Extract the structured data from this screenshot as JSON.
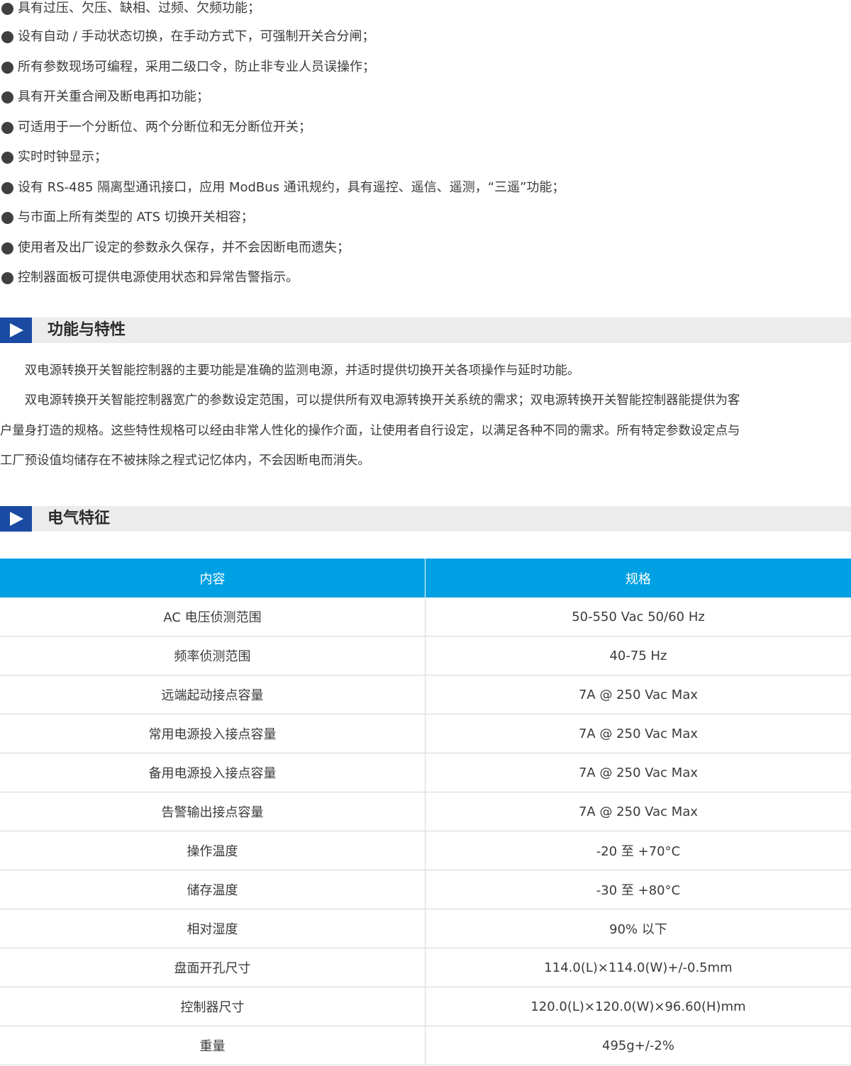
{
  "features": [
    "具有过压、欠压、缺相、过频、欠频功能；",
    "设有自动 / 手动状态切换，在手动方式下，可强制开关合分闸；",
    "所有参数现场可编程，采用二级口令，防止非专业人员误操作；",
    "具有开关重合闸及断电再扣功能；",
    "可适用于一个分断位、两个分断位和无分断位开关；",
    "实时时钟显示；",
    "设有 RS-485 隔离型通讯接口，应用 ModBus 通讯规约，具有遥控、遥信、遥测，“三遥”功能；",
    "与市面上所有类型的 ATS 切换开关相容；",
    "使用者及出厂设定的参数永久保存，并不会因断电而遗失；",
    "控制器面板可提供电源使用状态和异常告警指示。"
  ],
  "section1": {
    "title": "功能与特性",
    "lines": [
      "　　双电源转换开关智能控制器的主要功能是准确的监测电源，并适时提供切换开关各项操作与延时功能。",
      "　　双电源转换开关智能控制器宽广的参数设定范围，可以提供所有双电源转换开关系统的需求；双电源转换开关智能控制器能提供为客",
      "户量身打造的规格。这些特性规格可以经由非常人性化的操作介面，让使用者自行设定，以满足各种不同的需求。所有特定参数设定点与",
      "工厂预设值均储存在不被抹除之程式记忆体内，不会因断电而消失。"
    ]
  },
  "section2": {
    "title": "电气特征"
  },
  "table": {
    "headers": [
      "内容",
      "规格"
    ],
    "rows": [
      [
        "AC 电压侦测范围",
        "50-550 Vac 50/60 Hz"
      ],
      [
        "频率侦测范围",
        "40-75 Hz"
      ],
      [
        "远端起动接点容量",
        "7A @ 250 Vac Max"
      ],
      [
        "常用电源投入接点容量",
        "7A @ 250 Vac Max"
      ],
      [
        "备用电源投入接点容量",
        "7A @ 250 Vac Max"
      ],
      [
        "告警输出接点容量",
        "7A @ 250 Vac Max"
      ],
      [
        "操作温度",
        "-20 至 +70°C"
      ],
      [
        "储存温度",
        "-30 至 +80°C"
      ],
      [
        "相对湿度",
        "90% 以下"
      ],
      [
        "盘面开孔尺寸",
        "114.0(L)×114.0(W)+/-0.5mm"
      ],
      [
        "控制器尺寸",
        "120.0(L)×120.0(W)×96.60(H)mm"
      ],
      [
        "重量",
        "495g+/-2%"
      ]
    ]
  },
  "colors": {
    "section_marker": "#1a4aa2",
    "section_bg": "#ececec",
    "table_header_bg": "#00a0e4",
    "row_divider": "#d7d7d7",
    "text": "#3a3a3a"
  }
}
